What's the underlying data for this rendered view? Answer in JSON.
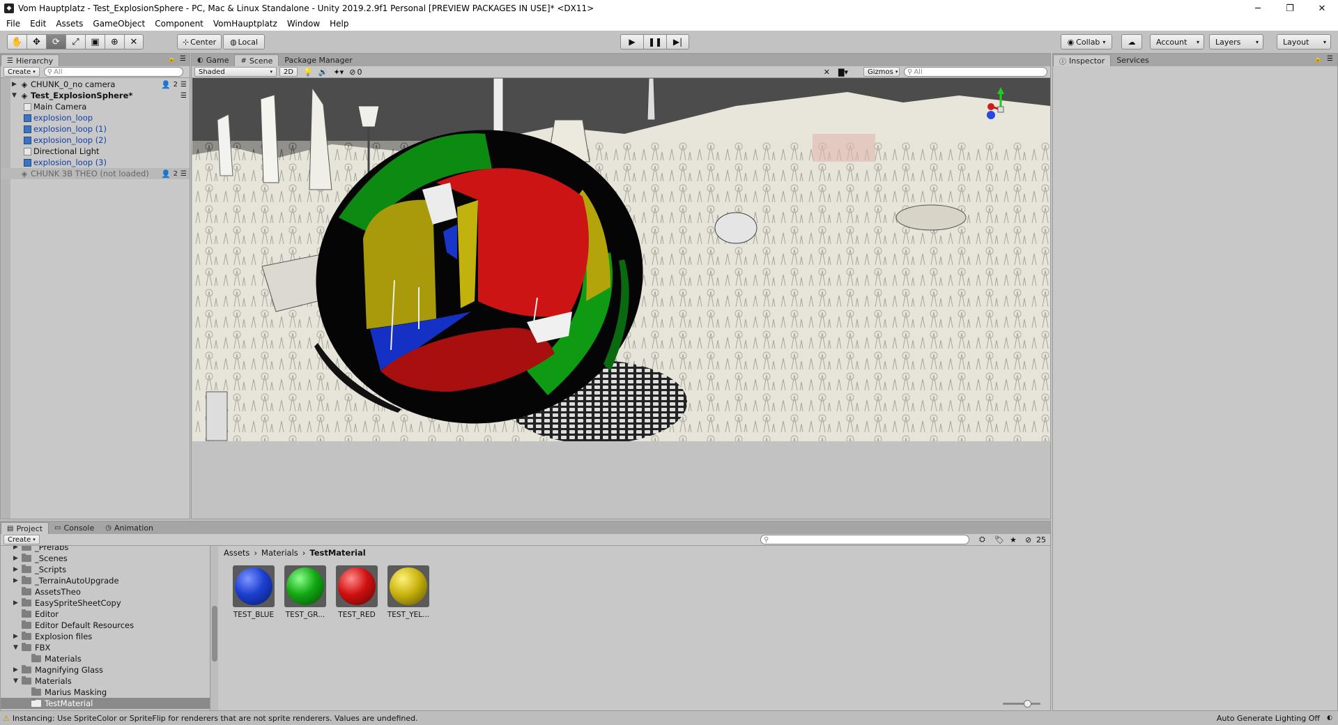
{
  "window": {
    "title": "Vom Hauptplatz - Test_ExplosionSphere - PC, Mac & Linux Standalone - Unity 2019.2.9f1 Personal [PREVIEW PACKAGES IN USE]* <DX11>",
    "minimize": "─",
    "maximize": "❐",
    "close": "✕"
  },
  "menu": [
    "File",
    "Edit",
    "Assets",
    "GameObject",
    "Component",
    "VomHauptplatz",
    "Window",
    "Help"
  ],
  "toolbar": {
    "tools": [
      "hand-tool",
      "move-tool",
      "rotate-tool",
      "scale-tool",
      "rect-tool",
      "transform-tool",
      "custom-tool"
    ],
    "pivot_label": "Center",
    "space_label": "Local",
    "collab_label": "Collab",
    "account_label": "Account",
    "layers_label": "Layers",
    "layout_label": "Layout"
  },
  "hierarchy": {
    "tab_label": "Hierarchy",
    "create_label": "Create",
    "search_placeholder": "All",
    "rows": [
      {
        "label": "CHUNK_0_no camera",
        "count": "2"
      },
      {
        "label": "Test_ExplosionSphere*"
      },
      {
        "label": "Main Camera"
      },
      {
        "label": "explosion_loop"
      },
      {
        "label": "explosion_loop (1)"
      },
      {
        "label": "explosion_loop (2)"
      },
      {
        "label": "Directional Light"
      },
      {
        "label": "explosion_loop (3)"
      },
      {
        "label": "CHUNK 3B THEO (not loaded)",
        "count": "2"
      }
    ]
  },
  "scene": {
    "tabs": {
      "game": "Game",
      "scene": "Scene",
      "package_manager": "Package Manager"
    },
    "shading_mode": "Shaded",
    "mode_2d": "2D",
    "effects_count": "0",
    "gizmos_label": "Gizmos",
    "search_placeholder": "All"
  },
  "inspector": {
    "tab_label": "Inspector",
    "services_label": "Services"
  },
  "project": {
    "tabs": {
      "project": "Project",
      "console": "Console",
      "animation": "Animation"
    },
    "create_label": "Create",
    "hidden_count": "25",
    "folders": [
      {
        "label": "_Prefabs"
      },
      {
        "label": "_Scenes"
      },
      {
        "label": "_Scripts"
      },
      {
        "label": "_TerrainAutoUpgrade"
      },
      {
        "label": "AssetsTheo"
      },
      {
        "label": "EasySpriteSheetCopy"
      },
      {
        "label": "Editor"
      },
      {
        "label": "Editor Default Resources"
      },
      {
        "label": "Explosion files"
      },
      {
        "label": "FBX"
      },
      {
        "label": "Materials"
      },
      {
        "label": "Magnifying Glass"
      },
      {
        "label": "Materials"
      },
      {
        "label": "Marius Masking"
      },
      {
        "label": "TestMaterial"
      }
    ],
    "breadcrumb": [
      "Assets",
      "Materials",
      "TestMaterial"
    ],
    "assets": [
      {
        "label": "TEST_BLUE",
        "color": "#1c3fd0"
      },
      {
        "label": "TEST_GR...",
        "color": "#13a813"
      },
      {
        "label": "TEST_RED",
        "color": "#d01010"
      },
      {
        "label": "TEST_YEL...",
        "color": "#c9b40e"
      }
    ]
  },
  "status": {
    "message": "Instancing: Use SpriteColor or SpriteFlip for renderers that are not sprite renderers. Values are undefined.",
    "right_text": "Auto Generate Lighting Off"
  }
}
